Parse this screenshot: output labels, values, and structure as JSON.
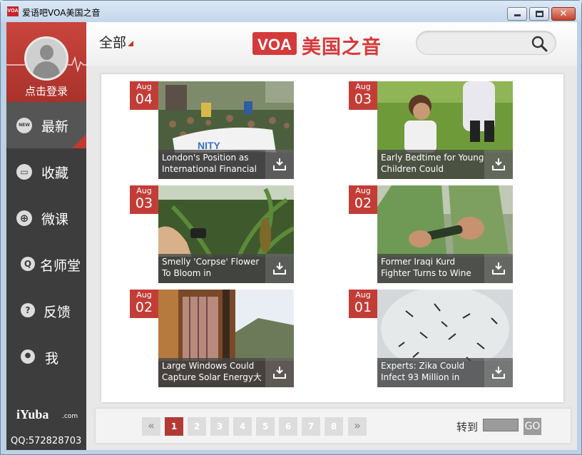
{
  "window": {
    "title": "爱语吧VOA美国之音",
    "icon_text": "VOA"
  },
  "sidebar": {
    "login_label": "点击登录",
    "nav": [
      {
        "label": "最新",
        "icon": "new-badge-icon",
        "glyph": "NEW",
        "active": true
      },
      {
        "label": "收藏",
        "icon": "favorites-box-icon",
        "glyph": "▭"
      },
      {
        "label": "微课",
        "icon": "crosshair-icon",
        "glyph": "⊕"
      },
      {
        "label": "名师堂",
        "icon": "teacher-q-icon",
        "glyph": "Q"
      },
      {
        "label": "反馈",
        "icon": "help-question-icon",
        "glyph": "?"
      },
      {
        "label": "我",
        "icon": "user-icon",
        "glyph": "●"
      }
    ],
    "brand": "iYuba",
    "brand_suffix": ".com",
    "qq": "QQ:572828703"
  },
  "header": {
    "category": "全部",
    "logo_text": "VOA",
    "brand_name": "美国之音",
    "search_placeholder": ""
  },
  "articles": [
    {
      "month": "Aug",
      "day": "04",
      "title": "London's Position as International Financial",
      "img": "crowd-protest"
    },
    {
      "month": "Aug",
      "day": "03",
      "title": "Early Bedtime for Young Children Could",
      "img": "girl-grass"
    },
    {
      "month": "Aug",
      "day": "03",
      "title": "Smelly 'Corpse' Flower To Bloom in",
      "img": "greenhouse"
    },
    {
      "month": "Aug",
      "day": "02",
      "title": "Former Iraqi Kurd Fighter Turns to Wine",
      "img": "wine-bottle"
    },
    {
      "month": "Aug",
      "day": "02",
      "title": "Large Windows Could Capture Solar Energy大",
      "img": "windows"
    },
    {
      "month": "Aug",
      "day": "01",
      "title": "Experts: Zika Could Infect 93 Million in",
      "img": "mosquitoes"
    }
  ],
  "pager": {
    "prev": "«",
    "pages": [
      "1",
      "2",
      "3",
      "4",
      "5",
      "6",
      "7",
      "8"
    ],
    "current": "1",
    "next": "»",
    "goto_label": "转到",
    "go_label": "GO"
  },
  "colors": {
    "accent": "#c33d37",
    "sidebar": "#3d3d3d"
  }
}
